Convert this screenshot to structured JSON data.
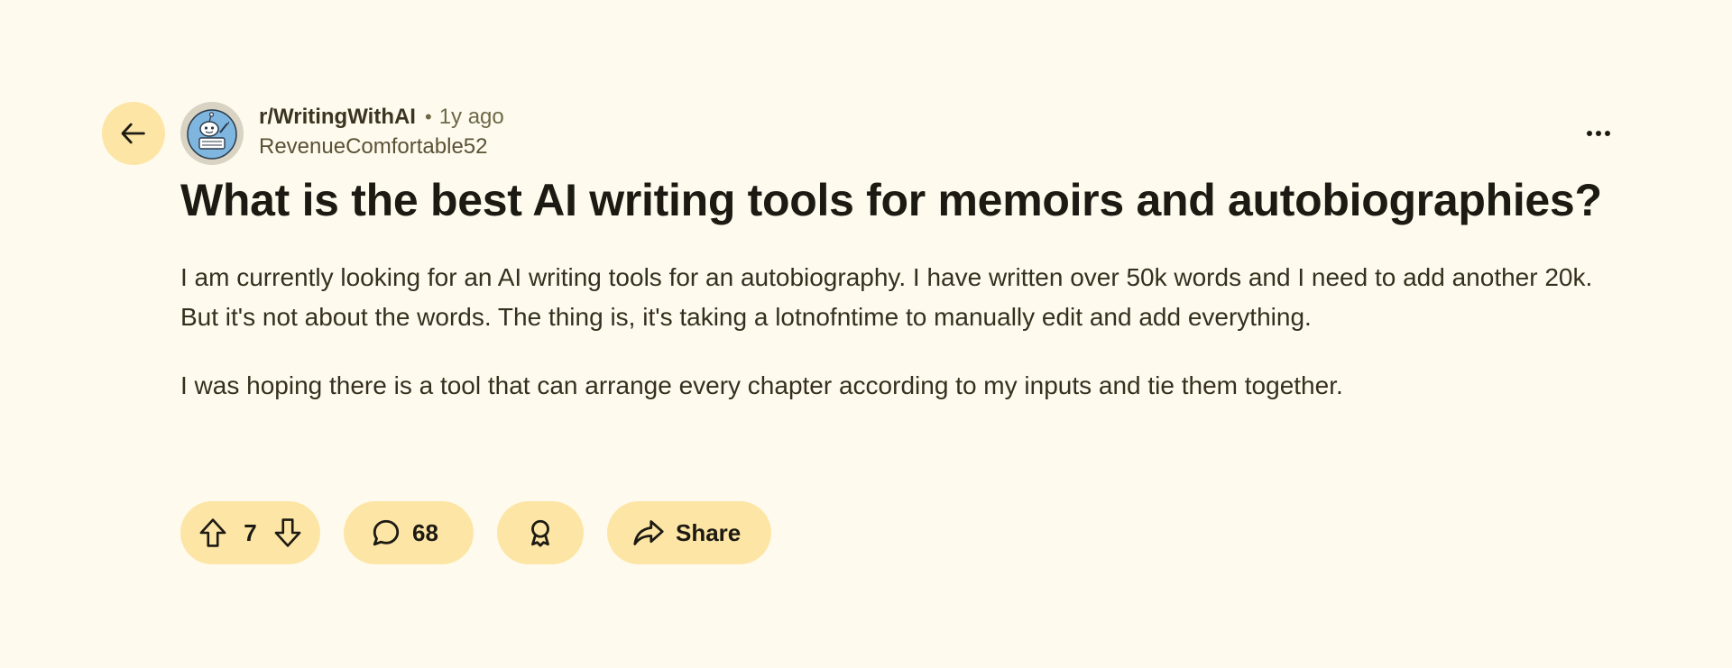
{
  "post": {
    "subreddit": "r/WritingWithAI",
    "separator": "•",
    "time_ago": "1y ago",
    "author": "RevenueComfortable52",
    "title": "What is the best AI writing tools for memoirs and autobiographies?",
    "body": [
      "I am currently looking for an AI writing tools for an autobiography. I have written over 50k words and I need to add another 20k. But it's not about the words. The thing is, it's taking a lotnofntime to manually edit and add everything.",
      "I was hoping there is a tool that can arrange every chapter according to my inputs and tie them together."
    ]
  },
  "actions": {
    "vote_count": "7",
    "comment_count": "68",
    "share_label": "Share"
  },
  "icons": {
    "back": "arrow-left-icon",
    "more": "more-horizontal-icon",
    "upvote": "arrow-up-icon",
    "downvote": "arrow-down-icon",
    "comment": "speech-bubble-icon",
    "award": "award-ribbon-icon",
    "share": "share-arrow-icon",
    "avatar": "subreddit-avatar-icon"
  },
  "colors": {
    "background": "#fefbee",
    "pill": "#fde5a6",
    "text_primary": "#1c1a12",
    "text_secondary": "#6e6848",
    "avatar_blue": "#7fb6e0"
  }
}
